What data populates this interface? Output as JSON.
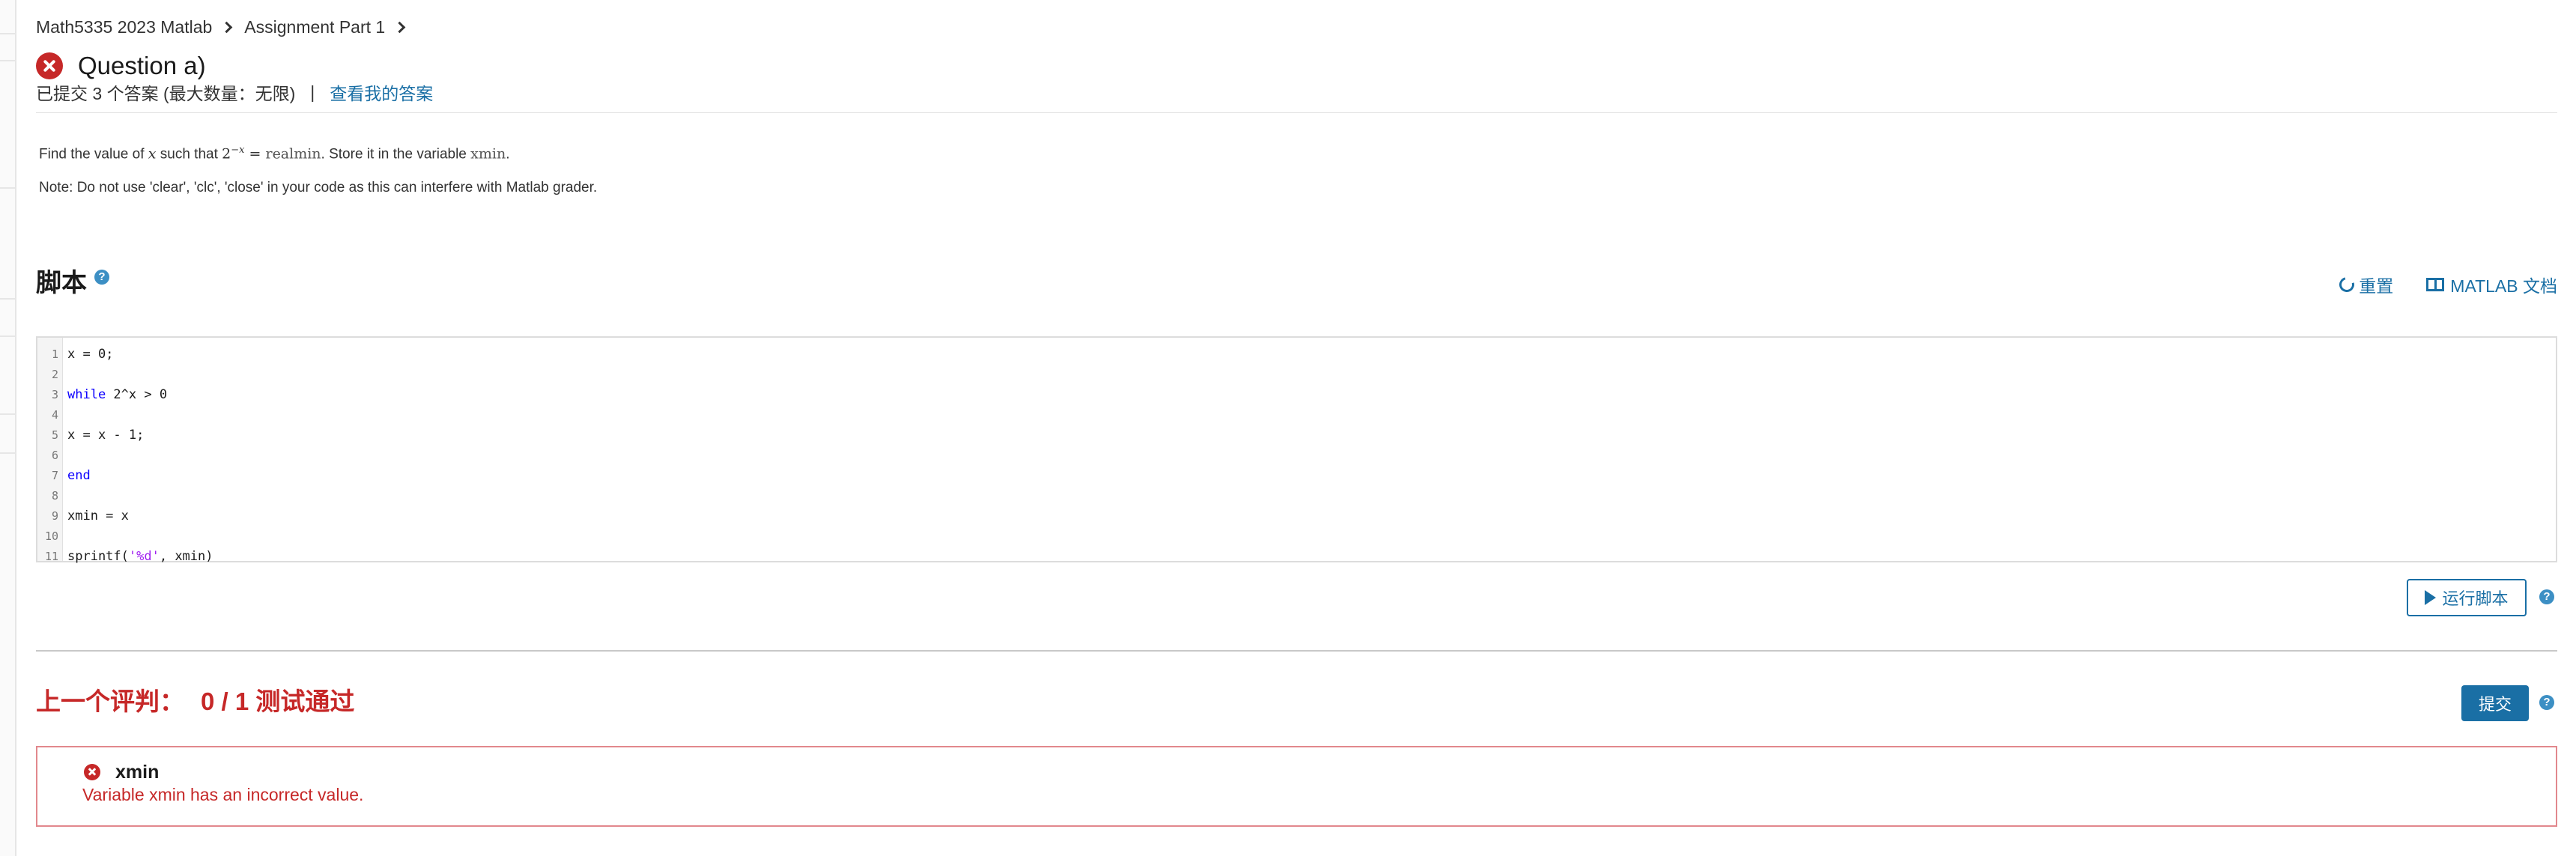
{
  "breadcrumb": [
    "Math5335 2023 Matlab",
    "Assignment Part 1"
  ],
  "question": {
    "title": "Question a)",
    "status": "incorrect"
  },
  "submissions": {
    "text": "已提交 3 个答案 (最大数量：无限)",
    "separator": "|",
    "view_link": "查看我的答案"
  },
  "problem": {
    "p1": "Find the value of ",
    "var_x": "x",
    "p2": " such that ",
    "math_base": "2",
    "math_exp": "−x",
    "math_eq": " = ",
    "realmin": "realmin",
    "p3": ". Store it in the variable ",
    "xmin": "xmin",
    "p4": ".",
    "note": "Note: Do not use 'clear', 'clc', 'close' in your code as this can interfere with Matlab grader."
  },
  "script": {
    "title": "脚本",
    "reset_label": "重置",
    "docs_label": "MATLAB 文档",
    "lines": [
      {
        "n": "1",
        "code": "x = 0;"
      },
      {
        "n": "2",
        "code": ""
      },
      {
        "n": "3",
        "kw": "while",
        "code": " 2^x > 0"
      },
      {
        "n": "4",
        "code": ""
      },
      {
        "n": "5",
        "code": "x = x - 1;"
      },
      {
        "n": "6",
        "code": ""
      },
      {
        "n": "7",
        "kw": "end",
        "code": ""
      },
      {
        "n": "8",
        "code": ""
      },
      {
        "n": "9",
        "code": "xmin = x"
      },
      {
        "n": "10",
        "code": ""
      },
      {
        "n": "11",
        "pre": "sprintf(",
        "str": "'%d'",
        "post": ", xmin)"
      }
    ],
    "run_label": "运行脚本"
  },
  "grading": {
    "label": "上一个评判：",
    "score": "0 / 1 测试通过",
    "submit_label": "提交"
  },
  "result": {
    "title": "xmin",
    "message": "Variable xmin has an incorrect value."
  },
  "icons": {
    "question_status": "error-circle-icon",
    "help": "help-icon",
    "reset": "refresh-icon",
    "docs": "book-icon",
    "run": "play-icon",
    "result_status": "error-circle-icon"
  },
  "colors": {
    "link": "#1a6fa5",
    "error": "#c62828",
    "error_border": "#e2888d",
    "keyword": "#0d00ff",
    "string": "#a020f0",
    "help": "#3c8fc4"
  }
}
